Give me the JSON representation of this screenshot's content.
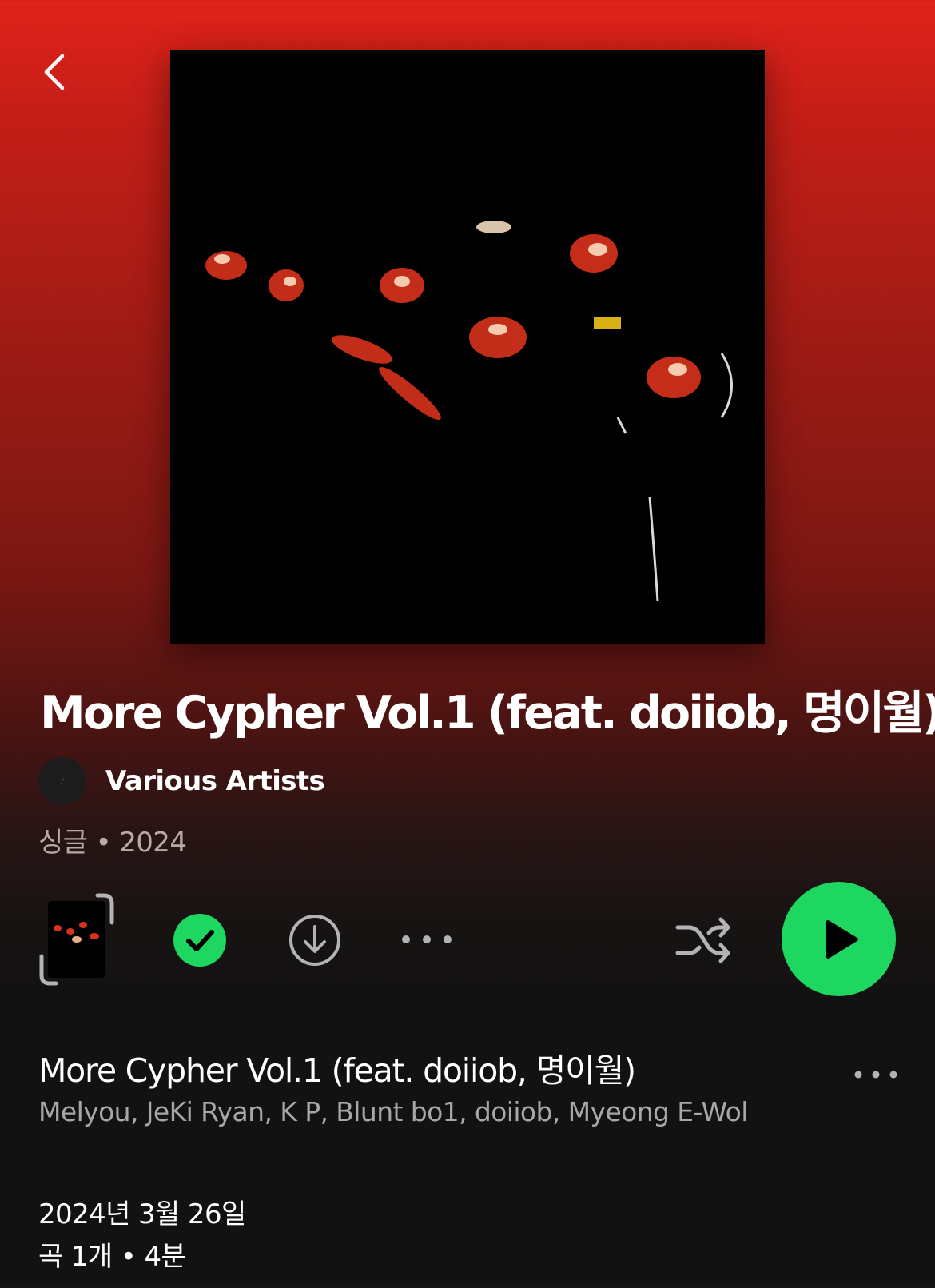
{
  "header": {
    "back_icon": "chevron-left-icon"
  },
  "album": {
    "cover_alt": "album-cover",
    "title": "More Cypher Vol.1 (feat. doiiob, 명이월)",
    "artist": "Various Artists",
    "meta": "싱글 • 2024"
  },
  "actions": {
    "preview_icon": "album-preview-icon",
    "saved_icon": "check-circle-icon",
    "download_icon": "download-icon",
    "more_icon": "more-horizontal-icon",
    "shuffle_icon": "shuffle-icon",
    "play_icon": "play-icon",
    "colors": {
      "accent": "#1ed760",
      "icon": "#b3b3b3"
    }
  },
  "tracks": [
    {
      "title": "More Cypher Vol.1 (feat. doiiob, 명이월)",
      "artists": "Melyou, JeKi Ryan, K P, Blunt bo1, doiiob, Myeong E-Wol"
    }
  ],
  "footer": {
    "release_date": "2024년 3월 26일",
    "summary": "곡 1개 • 4분"
  }
}
